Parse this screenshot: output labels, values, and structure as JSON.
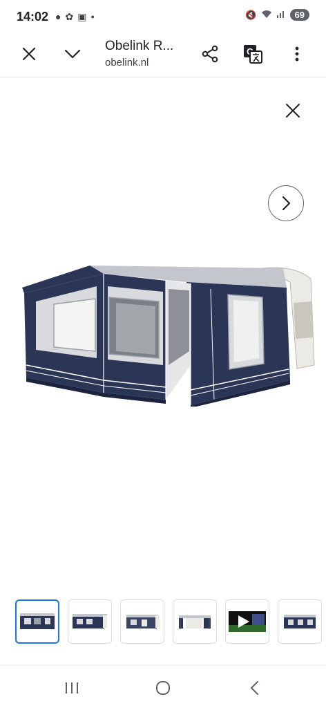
{
  "status_bar": {
    "time": "14:02",
    "left_icons": [
      "chat-bubble-icon",
      "flower-icon",
      "screenshot-icon",
      "dot-icon"
    ],
    "right_icons": [
      "mute-icon",
      "wifi-icon",
      "signal-icon"
    ],
    "battery": "69"
  },
  "toolbar": {
    "title": "Obelink R...",
    "url": "obelink.nl"
  },
  "viewer": {
    "image_subject": "caravan-awning-photo",
    "thumbnail_count": 6,
    "active_thumbnail": 0
  },
  "colors": {
    "accent": "#1a73e8",
    "awning_navy": "#2b3556",
    "awning_grey": "#d8dadd"
  }
}
